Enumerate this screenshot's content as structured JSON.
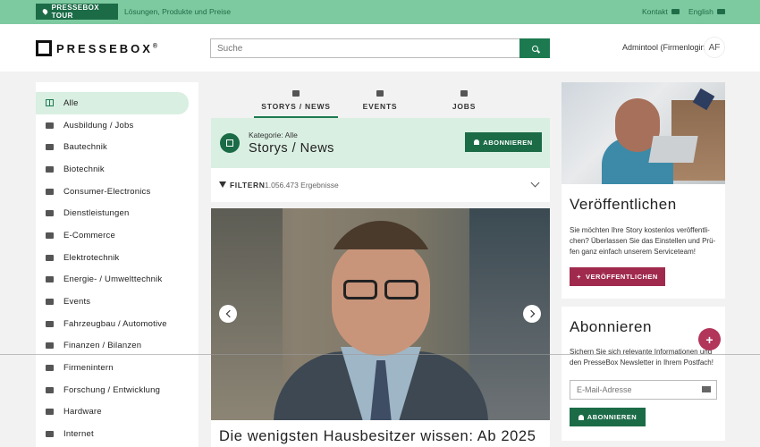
{
  "topbar": {
    "tour_label": "PRESSEBOX TOUR",
    "tour_subtitle": "Lösungen, Produkte und Preise",
    "kontakt": "Kontakt",
    "english": "English"
  },
  "header": {
    "logo_text": "PRESSEBOX",
    "logo_mark": "®",
    "search_placeholder": "Suche",
    "admin_label": "Admintool (Firmenlogin)",
    "avatar_initials": "AF"
  },
  "sidebar": {
    "items": [
      {
        "label": "Alle",
        "icon": "grid-icon"
      },
      {
        "label": "Ausbildung / Jobs",
        "icon": "briefcase-icon"
      },
      {
        "label": "Bautechnik",
        "icon": "excavator-icon"
      },
      {
        "label": "Biotechnik",
        "icon": "pipette-icon"
      },
      {
        "label": "Consumer-Electronics",
        "icon": "devices-icon"
      },
      {
        "label": "Dienstleistungen",
        "icon": "service-icon"
      },
      {
        "label": "E-Commerce",
        "icon": "cart-icon"
      },
      {
        "label": "Elektrotechnik",
        "icon": "bolt-icon"
      },
      {
        "label": "Energie- / Umwelttechnik",
        "icon": "solar-icon"
      },
      {
        "label": "Events",
        "icon": "calendar-icon"
      },
      {
        "label": "Fahrzeugbau / Automotive",
        "icon": "car-icon"
      },
      {
        "label": "Finanzen / Bilanzen",
        "icon": "piggy-bank-icon"
      },
      {
        "label": "Firmenintern",
        "icon": "building-icon"
      },
      {
        "label": "Forschung / Entwicklung",
        "icon": "lab-icon"
      },
      {
        "label": "Hardware",
        "icon": "chip-icon"
      },
      {
        "label": "Internet",
        "icon": "wifi-icon"
      }
    ]
  },
  "tabs": [
    {
      "label": "STORYS / NEWS",
      "icon": "newspaper-icon"
    },
    {
      "label": "EVENTS",
      "icon": "calendar-icon"
    },
    {
      "label": "JOBS",
      "icon": "briefcase-icon"
    }
  ],
  "category": {
    "label": "Kategorie: Alle",
    "title": "Storys / News",
    "subscribe_button": "ABONNIEREN"
  },
  "filter": {
    "label": "FILTERN",
    "count": "1.056.473 Ergebnisse"
  },
  "story": {
    "headline": "Die wenigsten Hausbesitzer wissen: Ab 2025"
  },
  "publish_card": {
    "title": "Veröffentlichen",
    "text": "Sie möchten Ihre Story kostenlos veröffentli­chen? Überlassen Sie das Einstellen und Prü­fen ganz einfach unserem Serviceteam!",
    "button": "VERÖFFENTLICHEN",
    "button_icon": "+"
  },
  "subscribe_card": {
    "title": "Abonnieren",
    "text": "Sichern Sie sich relevante Informationen und den PresseBox Newsletter in Ihrem Postfach!",
    "email_placeholder": "E-Mail-Adresse",
    "button": "ABONNIEREN"
  },
  "fab_symbol": "+",
  "colors": {
    "accent_green": "#1b6b47",
    "topbar_green": "#7ecaa0",
    "accent_pink": "#a02a4e",
    "soft_green": "#d9efe2"
  }
}
